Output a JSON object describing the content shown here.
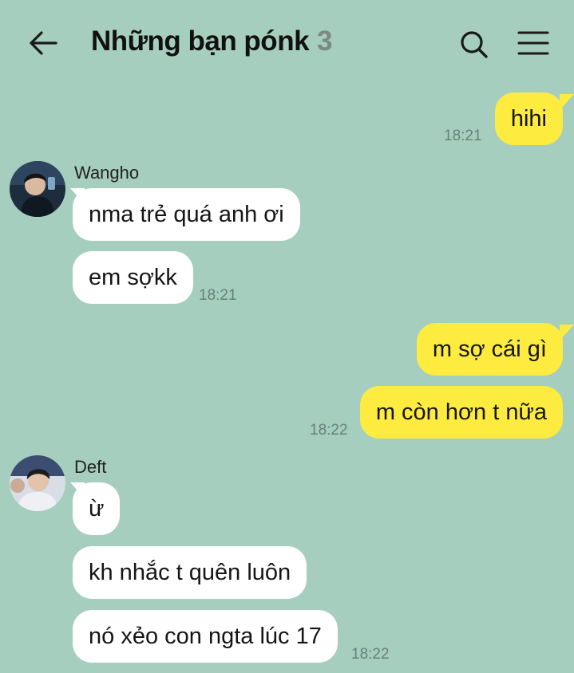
{
  "header": {
    "title": "Những bạn pónk",
    "member_count": "3"
  },
  "messages": [
    {
      "side": "out",
      "text": "hihi"
    },
    {
      "time": "18:21"
    },
    {
      "side": "in",
      "sender": "Wangho",
      "text": "nma trẻ quá anh ơi"
    },
    {
      "side": "in",
      "text": "em sợkk"
    },
    {
      "time": "18:21"
    },
    {
      "side": "out",
      "text": "m sợ cái gì"
    },
    {
      "side": "out",
      "text": "m còn hơn t nữa"
    },
    {
      "time": "18:22"
    },
    {
      "side": "in",
      "sender": "Deft",
      "text": "ừ"
    },
    {
      "side": "in",
      "text": "kh nhắc t quên luôn"
    },
    {
      "side": "in",
      "text": "nó xẻo con ngta lúc 17"
    },
    {
      "time": "18:22"
    }
  ],
  "colors": {
    "background": "#a6cebf",
    "incoming_bubble": "#ffffff",
    "outgoing_bubble": "#fdeb3f",
    "timestamp": "#66807a"
  },
  "icons": {
    "back": "arrow-left-icon",
    "search": "search-icon",
    "menu": "hamburger-menu-icon"
  }
}
